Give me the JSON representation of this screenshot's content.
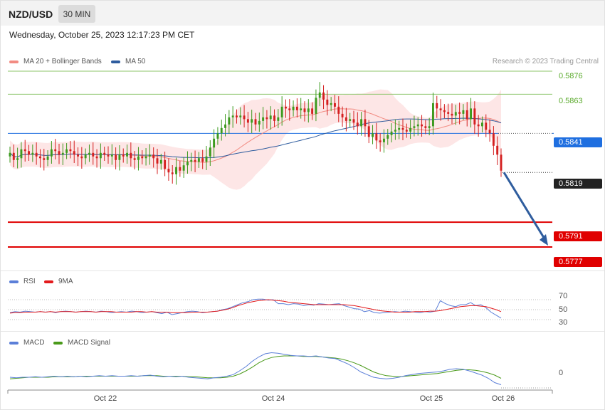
{
  "header": {
    "symbol": "NZD/USD",
    "timeframe": "30 MIN",
    "datetime": "Wednesday, October 25, 2023 12:17:23 PM CET"
  },
  "legend_main": [
    {
      "label": "MA 20 + Bollinger Bands",
      "color": "#f28b82"
    },
    {
      "label": "MA 50",
      "color": "#2e5c9e"
    }
  ],
  "credit": "Research © 2023 Trading Central",
  "legend_rsi": [
    {
      "label": "RSI",
      "color": "#5b7fd8"
    },
    {
      "label": "9MA",
      "color": "#e31a1c"
    }
  ],
  "legend_macd": [
    {
      "label": "MACD",
      "color": "#5b7fd8"
    },
    {
      "label": "MACD Signal",
      "color": "#4a9a1a"
    }
  ],
  "levels": [
    {
      "value": "0.5876",
      "style": "plain",
      "color": "#5aaa2c"
    },
    {
      "value": "0.5863",
      "style": "plain",
      "color": "#5aaa2c"
    },
    {
      "value": "0.5841",
      "style": "tag",
      "color": "#1f6fe0"
    },
    {
      "value": "0.5819",
      "style": "tag",
      "color": "#222222"
    },
    {
      "value": "0.5791",
      "style": "tag",
      "color": "#e00000"
    },
    {
      "value": "0.5777",
      "style": "tag",
      "color": "#e00000"
    }
  ],
  "rsi_ticks": [
    "70",
    "50",
    "30"
  ],
  "macd_ticks": [
    "0"
  ],
  "x_labels": [
    "Oct 22",
    "Oct 24",
    "Oct 25",
    "Oct 26"
  ],
  "chart_data": {
    "type": "candlestick",
    "ylim": [
      0.5765,
      0.5882
    ],
    "last_price": 0.5819,
    "resistance": [
      0.5876,
      0.5863
    ],
    "pivot": 0.5841,
    "support": [
      0.5791,
      0.5777
    ],
    "forecast_arrow": {
      "from": 0.5819,
      "to": 0.5777
    },
    "closes": [
      0.583,
      0.5826,
      0.5827,
      0.5832,
      0.5831,
      0.5829,
      0.583,
      0.5828,
      0.5827,
      0.5826,
      0.5828,
      0.5832,
      0.5831,
      0.5829,
      0.583,
      0.5832,
      0.5831,
      0.5829,
      0.5828,
      0.5827,
      0.5829,
      0.583,
      0.5828,
      0.5827,
      0.583,
      0.5829,
      0.5828,
      0.5829,
      0.5826,
      0.5829,
      0.5828,
      0.583,
      0.5827,
      0.5826,
      0.5828,
      0.5827,
      0.5828,
      0.5829,
      0.5827,
      0.5824,
      0.5826,
      0.5821,
      0.5819,
      0.5818,
      0.5822,
      0.582,
      0.5823,
      0.5825,
      0.5826,
      0.5825,
      0.5827,
      0.5825,
      0.5828,
      0.5833,
      0.5838,
      0.5841,
      0.5844,
      0.5846,
      0.585,
      0.5851,
      0.585,
      0.5851,
      0.5849,
      0.5847,
      0.5849,
      0.5846,
      0.5848,
      0.585,
      0.5849,
      0.5851,
      0.5848,
      0.585,
      0.5856,
      0.5855,
      0.5854,
      0.5856,
      0.5854,
      0.5855,
      0.5853,
      0.5855,
      0.5852,
      0.5861,
      0.5864,
      0.586,
      0.5857,
      0.5858,
      0.5856,
      0.5852,
      0.585,
      0.5848,
      0.5849,
      0.5847,
      0.5845,
      0.5849,
      0.5845,
      0.5839,
      0.5841,
      0.5837,
      0.5836,
      0.5838,
      0.584,
      0.5842,
      0.5843,
      0.5844,
      0.5843,
      0.5842,
      0.5844,
      0.5845,
      0.5846,
      0.5845,
      0.5844,
      0.5845,
      0.5858,
      0.5855,
      0.5854,
      0.5853,
      0.5852,
      0.5851,
      0.5853,
      0.5852,
      0.5854,
      0.5849,
      0.5855,
      0.5846,
      0.5845,
      0.5847,
      0.5843,
      0.5841,
      0.5834,
      0.5829,
      0.582
    ]
  },
  "rsi_data": [
    44,
    46,
    45,
    47,
    46,
    45,
    46,
    45,
    46,
    44,
    46,
    47,
    46,
    45,
    46,
    47,
    46,
    45,
    47,
    46,
    44,
    45,
    46,
    45,
    47,
    46,
    44,
    45,
    46,
    44,
    42,
    45,
    40,
    42,
    44,
    46,
    47,
    46,
    44,
    45,
    46,
    47,
    50,
    52,
    56,
    60,
    64,
    66,
    70,
    71,
    71,
    69,
    70,
    62,
    62,
    60,
    62,
    61,
    58,
    60,
    59,
    62,
    61,
    60,
    61,
    62,
    58,
    55,
    52,
    51,
    46,
    48,
    44,
    43,
    44,
    45,
    46,
    45,
    47,
    46,
    45,
    44,
    46,
    45,
    47,
    68,
    62,
    58,
    56,
    60,
    60,
    64,
    58,
    60,
    54,
    45,
    39,
    33
  ],
  "rsi_ma": [
    43,
    44,
    44,
    45,
    45,
    45,
    46,
    45,
    46,
    45,
    46,
    46,
    46,
    45,
    46,
    46,
    46,
    45,
    46,
    46,
    46,
    45,
    45,
    45,
    45,
    46,
    46,
    45,
    46,
    45,
    45,
    45,
    44,
    44,
    44,
    44,
    45,
    45,
    45,
    45,
    46,
    47,
    49,
    51,
    54,
    58,
    61,
    64,
    66,
    68,
    69,
    70,
    69,
    68,
    67,
    65,
    64,
    63,
    62,
    61,
    60,
    60,
    60,
    60,
    60,
    60,
    60,
    59,
    58,
    56,
    54,
    52,
    50,
    48,
    47,
    46,
    45,
    45,
    45,
    45,
    46,
    46,
    46,
    47,
    47,
    48,
    50,
    52,
    54,
    56,
    57,
    58,
    58,
    57,
    56,
    53,
    50,
    46
  ],
  "macd_data": [
    0,
    -1,
    0,
    0,
    1,
    0,
    1,
    2,
    1,
    2,
    1,
    2,
    1,
    2,
    3,
    2,
    3,
    2,
    2,
    3,
    2,
    3,
    4,
    2,
    1,
    2,
    1,
    2,
    0,
    -1,
    -2,
    -3,
    -1,
    0,
    2,
    5,
    12,
    20,
    30,
    38,
    44,
    46,
    45,
    43,
    41,
    40,
    40,
    39,
    40,
    38,
    36,
    35,
    30,
    25,
    18,
    10,
    5,
    0,
    -2,
    -3,
    -2,
    0,
    3,
    5,
    7,
    8,
    9,
    10,
    12,
    15,
    16,
    15,
    12,
    8,
    4,
    -2,
    -10,
    -14
  ],
  "macd_signal": [
    -3,
    -2,
    -1,
    0,
    0,
    0,
    0,
    1,
    1,
    1,
    1,
    2,
    2,
    2,
    2,
    2,
    2,
    2,
    2,
    2,
    2,
    3,
    3,
    3,
    2,
    2,
    2,
    2,
    1,
    1,
    0,
    -1,
    -1,
    -1,
    0,
    2,
    6,
    12,
    19,
    27,
    33,
    37,
    39,
    40,
    40,
    40,
    39,
    39,
    39,
    38,
    37,
    36,
    34,
    31,
    27,
    22,
    16,
    10,
    6,
    3,
    2,
    1,
    2,
    3,
    4,
    5,
    6,
    7,
    9,
    11,
    13,
    14,
    14,
    13,
    11,
    8,
    4,
    -2
  ]
}
